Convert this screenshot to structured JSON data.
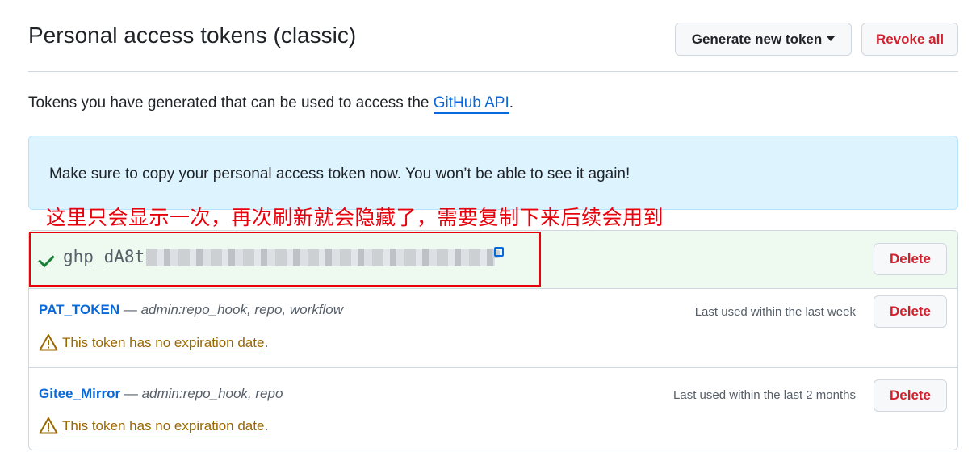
{
  "header": {
    "title": "Personal access tokens (classic)",
    "generate_label": "Generate new token",
    "revoke_label": "Revoke all"
  },
  "intro": {
    "text": "Tokens you have generated that can be used to access the ",
    "link": "GitHub API",
    "suffix": "."
  },
  "flash": {
    "text": "Make sure to copy your personal access token now. You won’t be able to see it again!"
  },
  "annotation": {
    "text": "这里只会显示一次，再次刷新就会隐藏了，需要复制下来后续会用到",
    "color": "#e8000b"
  },
  "new_token": {
    "value_visible": "ghp_dA8t",
    "delete_label": "Delete"
  },
  "tokens": [
    {
      "name": "PAT_TOKEN",
      "dash": "—",
      "scopes": "admin:repo_hook, repo, workflow",
      "last_used": "Last used within the last week",
      "warning": "This token has no expiration date",
      "warning_suffix": ".",
      "delete_label": "Delete"
    },
    {
      "name": "Gitee_Mirror",
      "dash": "—",
      "scopes": "admin:repo_hook, repo",
      "last_used": "Last used within the last 2 months",
      "warning": "This token has no expiration date",
      "warning_suffix": ".",
      "delete_label": "Delete"
    }
  ],
  "icons": {
    "check": "check-icon",
    "copy": "copy-icon",
    "warning": "alert-triangle-icon",
    "caret": "caret-down-icon"
  },
  "colors": {
    "link": "#0969da",
    "danger": "#cf222e",
    "success": "#1a7f37",
    "warning": "#9a6700",
    "flash_bg": "#ddf4ff",
    "new_row_bg": "#eefaf0"
  }
}
